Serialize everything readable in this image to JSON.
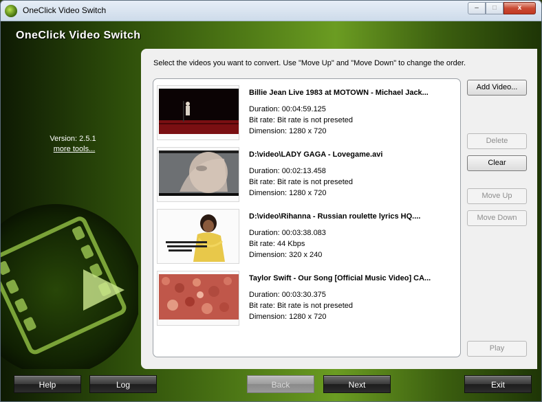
{
  "window": {
    "title": "OneClick Video Switch",
    "minimize_icon": "–",
    "maximize_icon": "□",
    "close_icon": "x"
  },
  "app": {
    "title": "OneClick Video Switch",
    "version": "Version: 2.5.1",
    "more_tools": "more tools..."
  },
  "main": {
    "instructions": "Select the videos you want to convert. Use \"Move Up\" and \"Move Down\" to change the order.",
    "videos": [
      {
        "title": "Billie Jean Live 1983 at MOTOWN - Michael Jack...",
        "duration": "Duration: 00:04:59.125",
        "bitrate": "Bit rate: Bit rate is not preseted",
        "dimension": "Dimension: 1280 x 720"
      },
      {
        "title": "D:\\video\\LADY GAGA - Lovegame.avi",
        "duration": "Duration: 00:02:13.458",
        "bitrate": "Bit rate: Bit rate is not preseted",
        "dimension": "Dimension: 1280 x 720"
      },
      {
        "title": "D:\\video\\Rihanna - Russian roulette lyrics HQ....",
        "duration": "Duration: 00:03:38.083",
        "bitrate": "Bit rate: 44 Kbps",
        "dimension": "Dimension: 320 x 240"
      },
      {
        "title": "Taylor Swift - Our Song [Official Music Video] CA...",
        "duration": "Duration: 00:03:30.375",
        "bitrate": "Bit rate: Bit rate is not preseted",
        "dimension": "Dimension: 1280 x 720"
      }
    ]
  },
  "side_buttons": {
    "add_video": "Add Video...",
    "delete": "Delete",
    "clear": "Clear",
    "move_up": "Move Up",
    "move_down": "Move Down",
    "play": "Play"
  },
  "bottom_buttons": {
    "help": "Help",
    "log": "Log",
    "back": "Back",
    "next": "Next",
    "exit": "Exit"
  },
  "colors": {
    "accent_green": "#6b9c22",
    "panel_bg": "#f0f0f0"
  }
}
